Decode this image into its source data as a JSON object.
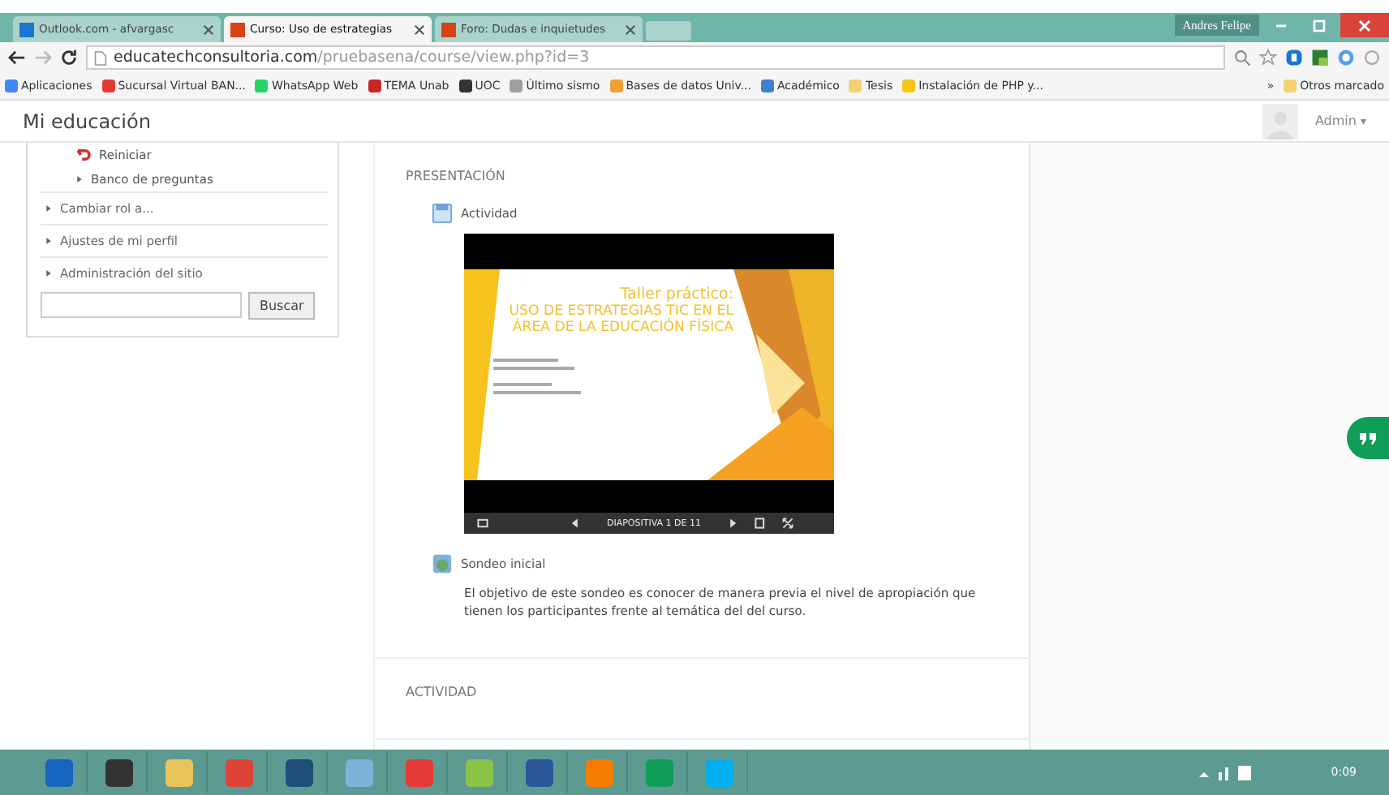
{
  "browser": {
    "tabs": [
      {
        "label": "Outlook.com - afvargasc",
        "selected": false,
        "kind": "mail"
      },
      {
        "label": "Curso: Uso de estrategias",
        "selected": true,
        "kind": "moodle"
      },
      {
        "label": "Foro: Dudas e inquietudes",
        "selected": false,
        "kind": "moodle"
      }
    ],
    "user": "Andres Felipe",
    "url_host": "educatechconsultoria.com",
    "url_path": "/pruebasena/course/view.php?id=3",
    "bookmarks": [
      {
        "label": "Aplicaciones",
        "kind": "apps"
      },
      {
        "label": "Sucursal Virtual BAN...",
        "kind": "bank"
      },
      {
        "label": "WhatsApp Web",
        "kind": "whatsapp"
      },
      {
        "label": "TEMA Unab",
        "kind": "tema"
      },
      {
        "label": "UOC",
        "kind": "uoc"
      },
      {
        "label": "Último sismo",
        "kind": "quake"
      },
      {
        "label": "Bases de datos Univ...",
        "kind": "db"
      },
      {
        "label": "Académico",
        "kind": "web"
      },
      {
        "label": "Tesis",
        "kind": "folder"
      },
      {
        "label": "Instalación de PHP y...",
        "kind": "php"
      }
    ],
    "more": "»",
    "other_bookmarks": "Otros marcado"
  },
  "site": {
    "title": "Mi educación",
    "user": "Admin",
    "user_caret": "▾"
  },
  "sidebar": {
    "items": [
      {
        "label": "Reiniciar",
        "kind": "reset"
      },
      {
        "label": "Banco de preguntas",
        "kind": "sub"
      },
      {
        "label": "Cambiar rol a...",
        "kind": "node"
      },
      {
        "label": "Ajustes de mi perfil",
        "kind": "node"
      },
      {
        "label": "Administración del sitio",
        "kind": "node"
      }
    ],
    "search_button": "Buscar"
  },
  "sections": [
    {
      "title": "PRESENTACIÓN",
      "activities": [
        {
          "kind": "page",
          "label": "Actividad",
          "slide": {
            "title": "Taller práctico:",
            "lines": [
              "USO DE ESTRATEGIAS TIC EN EL",
              "ÁREA DE LA EDUCACIÓN FÍSICA"
            ],
            "counter": "DIAPOSITIVA 1 DE 11"
          }
        },
        {
          "kind": "survey",
          "label": "Sondeo inicial",
          "description": "El objetivo de este sondeo es conocer de manera previa el nivel de apropiación que tienen los participantes frente al temática del del curso."
        }
      ]
    },
    {
      "title": "ACTIVIDAD"
    }
  ],
  "taskbar": {
    "apps": [
      {
        "kind": "outlook"
      },
      {
        "kind": "steam"
      },
      {
        "kind": "explorer"
      },
      {
        "kind": "chrome"
      },
      {
        "kind": "app"
      },
      {
        "kind": "paint"
      },
      {
        "kind": "pdf"
      },
      {
        "kind": "photos"
      },
      {
        "kind": "word"
      },
      {
        "kind": "media"
      },
      {
        "kind": "hangouts"
      },
      {
        "kind": "skype"
      }
    ],
    "clock": "0:09"
  }
}
